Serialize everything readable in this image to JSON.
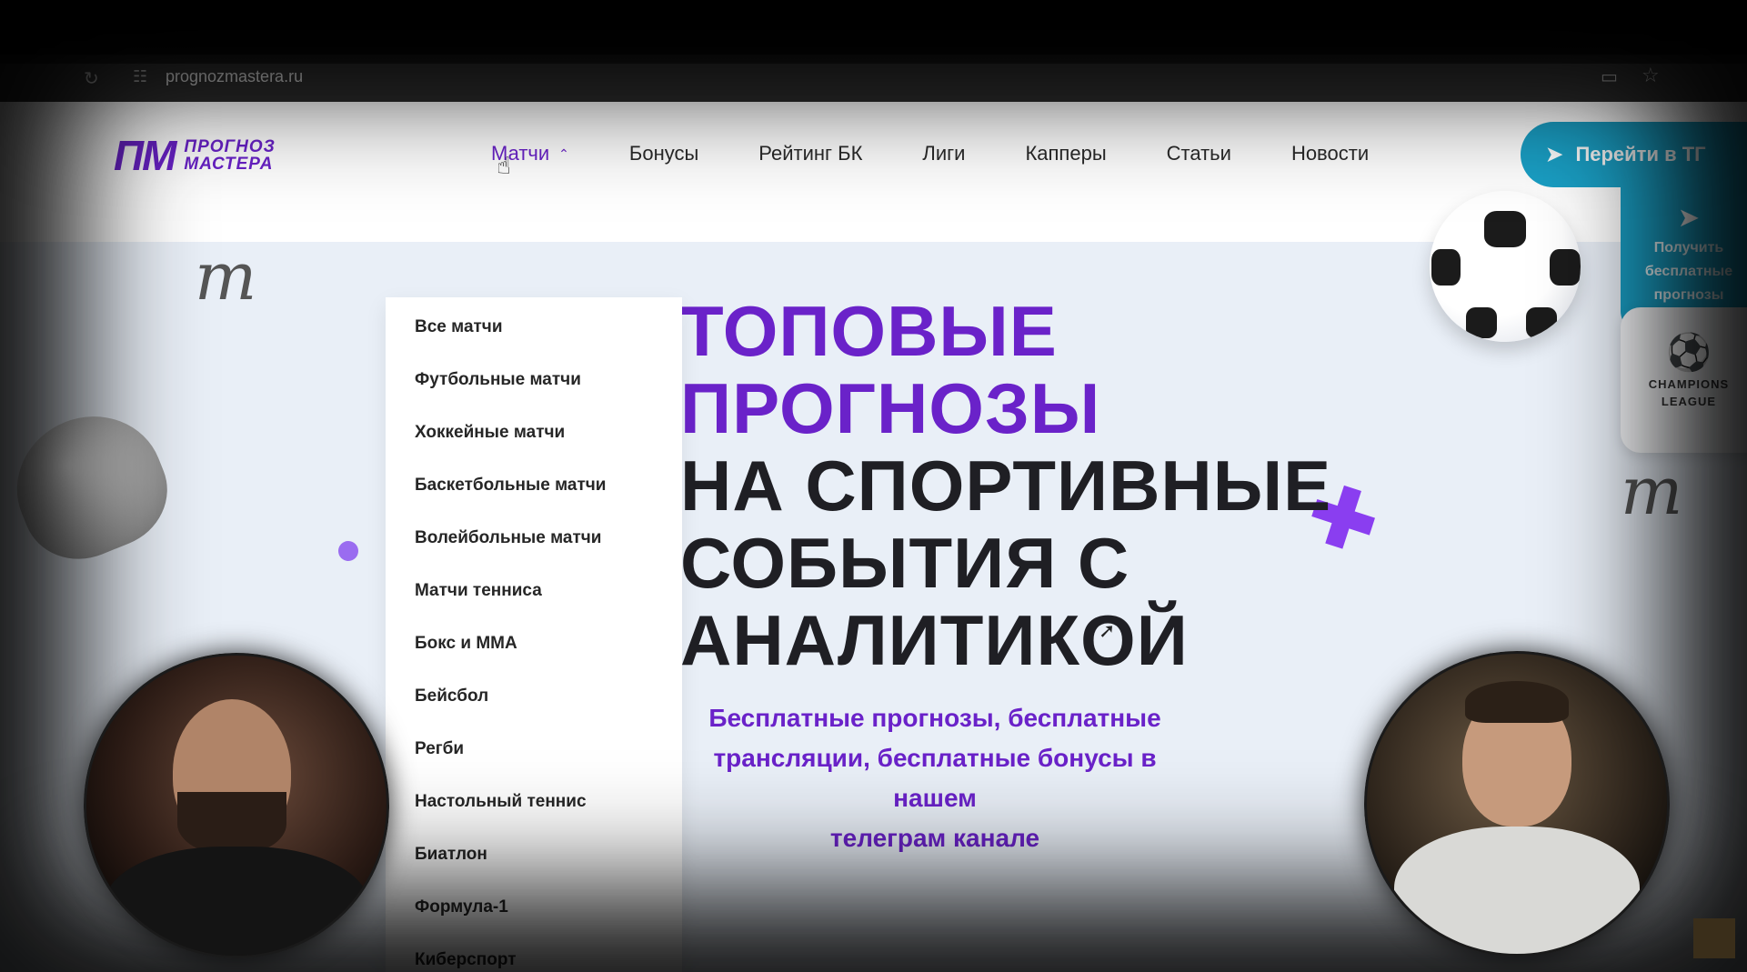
{
  "browser": {
    "url": "prognozmastera.ru",
    "reload_icon": "reload-icon",
    "star_icon": "bookmark-star-icon"
  },
  "site": {
    "logo": {
      "mark": "ПМ",
      "line1": "ПРОГНОЗ",
      "line2": "МАСТЕРА"
    },
    "nav": [
      {
        "label": "Матчи",
        "active": true
      },
      {
        "label": "Бонусы"
      },
      {
        "label": "Рейтинг БК"
      },
      {
        "label": "Лиги"
      },
      {
        "label": "Капперы"
      },
      {
        "label": "Статьи"
      },
      {
        "label": "Новости"
      }
    ],
    "tg_button": {
      "label": "Перейти в ТГ"
    },
    "tg_panel": {
      "line1": "Получить",
      "line2": "бесплатные",
      "line3": "прогнозы"
    },
    "cl_card": {
      "line1": "CHAMPIONS",
      "line2": "LEAGUE"
    },
    "dropdown": [
      "Все матчи",
      "Футбольные матчи",
      "Хоккейные матчи",
      "Баскетбольные матчи",
      "Волейбольные матчи",
      "Матчи тенниса",
      "Бокс и ММА",
      "Бейсбол",
      "Регби",
      "Настольный теннис",
      "Биатлон",
      "Формула-1",
      "Киберспорт"
    ],
    "hero": {
      "title": [
        "ТОПОВЫЕ",
        "ПРОГНОЗЫ",
        "НА СПОРТИВНЫЕ",
        "СОБЫТИЯ С",
        "АНАЛИТИКОЙ"
      ],
      "subtitle": [
        "Бесплатные прогнозы, бесплатные",
        "трансляции, бесплатные бонусы в нашем",
        "телеграм канале"
      ]
    }
  },
  "colors": {
    "brand_purple": "#6a22c9",
    "telegram_blue": "#1aa0c6",
    "hero_bg": "#e9eff7"
  }
}
